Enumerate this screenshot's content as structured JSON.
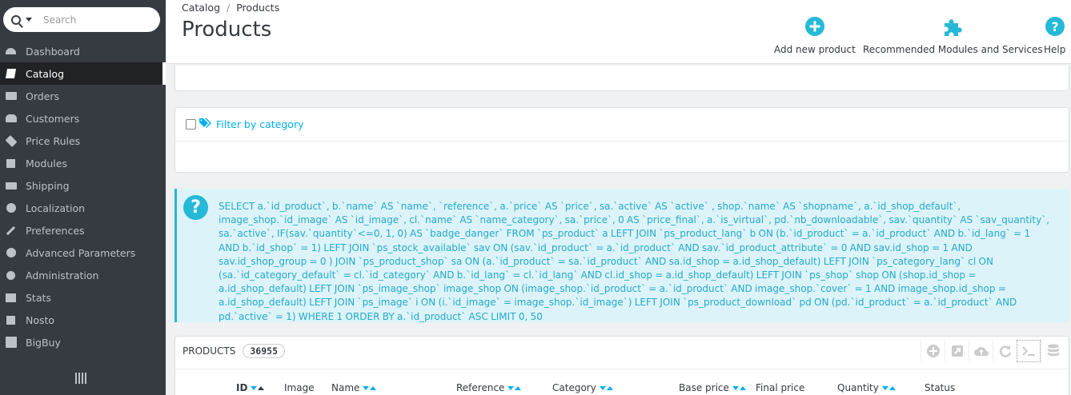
{
  "search": {
    "placeholder": "Search"
  },
  "sidebar": {
    "items": [
      {
        "label": "Dashboard"
      },
      {
        "label": "Catalog"
      },
      {
        "label": "Orders"
      },
      {
        "label": "Customers"
      },
      {
        "label": "Price Rules"
      },
      {
        "label": "Modules"
      },
      {
        "label": "Shipping"
      },
      {
        "label": "Localization"
      },
      {
        "label": "Preferences"
      },
      {
        "label": "Advanced Parameters"
      },
      {
        "label": "Administration"
      },
      {
        "label": "Stats"
      },
      {
        "label": "Nosto"
      },
      {
        "label": "BigBuy"
      }
    ],
    "active": "Catalog"
  },
  "header": {
    "breadcrumb": [
      "Catalog",
      "Products"
    ],
    "title": "Products",
    "toolbar": {
      "add": "Add new product",
      "modules": "Recommended Modules and Services",
      "help": "Help"
    }
  },
  "filter": {
    "label": "Filter by category"
  },
  "sql": {
    "query": "SELECT a.`id_product`, b.`name` AS `name`, `reference`, a.`price` AS `price`, sa.`active` AS `active` , shop.`name` AS `shopname`, a.`id_shop_default`, image_shop.`id_image` AS `id_image`, cl.`name` AS `name_category`, sa.`price`, 0 AS `price_final`, a.`is_virtual`, pd.`nb_downloadable`, sav.`quantity` AS `sav_quantity`, sa.`active`, IF(sav.`quantity`<=0, 1, 0) AS `badge_danger` FROM `ps_product` a LEFT JOIN `ps_product_lang` b ON (b.`id_product` = a.`id_product` AND b.`id_lang` = 1 AND b.`id_shop` = 1) LEFT JOIN `ps_stock_available` sav ON (sav.`id_product` = a.`id_product` AND sav.`id_product_attribute` = 0 AND sav.id_shop = 1 AND sav.id_shop_group = 0 ) JOIN `ps_product_shop` sa ON (a.`id_product` = sa.`id_product` AND sa.id_shop = a.id_shop_default) LEFT JOIN `ps_category_lang` cl ON (sa.`id_category_default` = cl.`id_category` AND b.`id_lang` = cl.`id_lang` AND cl.id_shop = a.id_shop_default) LEFT JOIN `ps_shop` shop ON (shop.id_shop = a.id_shop_default) LEFT JOIN `ps_image_shop` image_shop ON (image_shop.`id_product` = a.`id_product` AND image_shop.`cover` = 1 AND image_shop.id_shop = a.id_shop_default) LEFT JOIN `ps_image` i ON (i.`id_image` = image_shop.`id_image`) LEFT JOIN `ps_product_download` pd ON (pd.`id_product` = a.`id_product` AND pd.`active` = 1) WHERE 1 ORDER BY a.`id_product` ASC LIMIT 0, 50"
  },
  "products": {
    "label": "PRODUCTS",
    "count": "36955",
    "columns": [
      "ID",
      "Image",
      "Name",
      "Reference",
      "Category",
      "Base price",
      "Final price",
      "Quantity",
      "Status"
    ],
    "tools": [
      "add-icon",
      "export-icon",
      "cloud-upload-icon",
      "refresh-icon",
      "sql-query-icon",
      "database-icon"
    ]
  },
  "colors": {
    "sidebar_bg": "#363a41",
    "accent": "#25b9d7",
    "link": "#00aff0"
  }
}
